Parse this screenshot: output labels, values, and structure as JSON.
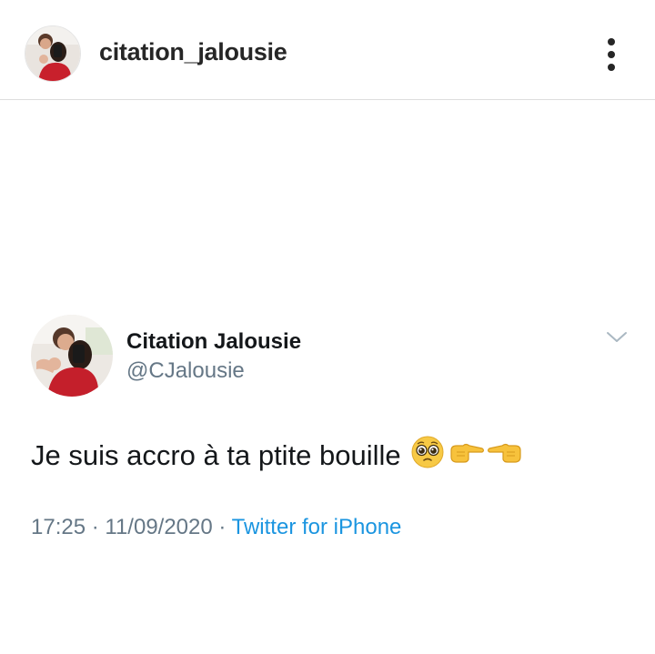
{
  "post_header": {
    "username": "citation_jalousie",
    "more_icon": "more-vertical-icon"
  },
  "tweet": {
    "display_name": "Citation Jalousie",
    "handle": "@CJalousie",
    "text": "Je suis accro à ta ptite bouille",
    "emojis": [
      "pleading-face-emoji",
      "pointing-right-emoji",
      "pointing-left-emoji"
    ],
    "time": "17:25",
    "separator": " · ",
    "date": "11/09/2020",
    "source": "Twitter for iPhone",
    "chevron_icon": "chevron-down-icon"
  },
  "colors": {
    "source_link": "#1b95e0",
    "muted_text": "#657786",
    "divider": "#dddddd"
  }
}
